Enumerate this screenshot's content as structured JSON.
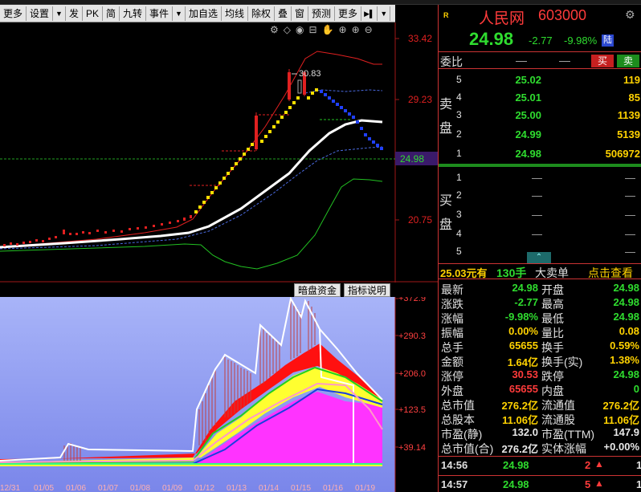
{
  "toolbar": {
    "items": [
      "更多",
      "设置",
      "发",
      "PK",
      "简",
      "九转",
      "事件",
      "加自选",
      "均线",
      "除权",
      "叠",
      "窗",
      "预测",
      "更多"
    ]
  },
  "main_chart": {
    "y_labels": [
      "33.42",
      "29.23",
      "24.98",
      "20.75"
    ],
    "peak_label": "30.83",
    "current_price_label": "24.98"
  },
  "sub_chart": {
    "buttons": [
      "暗盘资金",
      "指标说明"
    ],
    "y_labels": [
      "+372.9",
      "+290.3",
      "+206.0",
      "+123.5",
      "+39.14"
    ],
    "x_labels": [
      "12/31",
      "01/05",
      "01/06",
      "01/07",
      "01/08",
      "01/09",
      "01/12",
      "01/13",
      "01/14",
      "01/15",
      "01/16",
      "01/19"
    ]
  },
  "stock": {
    "market_logo": "R",
    "name": "人民网",
    "code": "603000",
    "last": "24.98",
    "change": "-2.77",
    "pct": "-9.98%",
    "market": "陆",
    "colors": {
      "up": "#ff3b3b",
      "down": "#2fdc2f",
      "volume": "#ffd200"
    }
  },
  "order_book": {
    "ratio_label": "委比",
    "ratio_dash_1": "—",
    "ratio_dash_2": "—",
    "buy_label": "买",
    "sell_label": "卖",
    "sell_side_label_1": "卖",
    "sell_side_label_2": "盘",
    "buy_side_label_1": "买",
    "buy_side_label_2": "盘",
    "sell": [
      {
        "level": "5",
        "price": "25.02",
        "vol": "119"
      },
      {
        "level": "4",
        "price": "25.01",
        "vol": "85"
      },
      {
        "level": "3",
        "price": "25.00",
        "vol": "1139"
      },
      {
        "level": "2",
        "price": "24.99",
        "vol": "5139"
      },
      {
        "level": "1",
        "price": "24.98",
        "vol": "506972"
      }
    ],
    "buy": [
      {
        "level": "1",
        "price": "—",
        "vol": "—"
      },
      {
        "level": "2",
        "price": "—",
        "vol": "—"
      },
      {
        "level": "3",
        "price": "—",
        "vol": "—"
      },
      {
        "level": "4",
        "price": "—",
        "vol": "—"
      },
      {
        "level": "5",
        "price": "—",
        "vol": "—"
      }
    ]
  },
  "big_order": {
    "price": "25.03元有",
    "hands": "130手",
    "label": "大卖单",
    "link": "点击查看"
  },
  "quote": [
    {
      "k1": "最新",
      "v1": "24.98",
      "c1": "grn",
      "k2": "开盘",
      "v2": "24.98",
      "c2": "grn"
    },
    {
      "k1": "涨跌",
      "v1": "-2.77",
      "c1": "grn",
      "k2": "最高",
      "v2": "24.98",
      "c2": "grn"
    },
    {
      "k1": "涨幅",
      "v1": "-9.98%",
      "c1": "grn",
      "k2": "最低",
      "v2": "24.98",
      "c2": "grn"
    },
    {
      "k1": "振幅",
      "v1": "0.00%",
      "c1": "yel",
      "k2": "量比",
      "v2": "0.08",
      "c2": "yel"
    },
    {
      "k1": "总手",
      "v1": "65655",
      "c1": "yel",
      "k2": "换手",
      "v2": "0.59%",
      "c2": "yel"
    },
    {
      "k1": "金额",
      "v1": "1.64亿",
      "c1": "yel",
      "k2": "换手(实)",
      "v2": "1.38%",
      "c2": "yel"
    },
    {
      "k1": "涨停",
      "v1": "30.53",
      "c1": "red",
      "k2": "跌停",
      "v2": "24.98",
      "c2": "grn"
    },
    {
      "k1": "外盘",
      "v1": "65655",
      "c1": "red",
      "k2": "内盘",
      "v2": "0",
      "c2": "grn"
    },
    {
      "k1": "总市值",
      "v1": "276.2亿",
      "c1": "yel",
      "k2": "流通值",
      "v2": "276.2亿",
      "c2": "yel"
    },
    {
      "k1": "总股本",
      "v1": "11.06亿",
      "c1": "yel",
      "k2": "流通股",
      "v2": "11.06亿",
      "c2": "yel"
    },
    {
      "k1": "市盈(静)",
      "v1": "132.0",
      "c1": "wht",
      "k2": "市盈(TTM)",
      "v2": "147.9",
      "c2": "wht"
    },
    {
      "k1": "总市值(合)",
      "v1": "276.2亿",
      "c1": "wht",
      "k2": "实体涨幅",
      "v2": "+0.00%",
      "c2": "wht"
    }
  ],
  "ticks": [
    {
      "time": "14:56",
      "price": "24.98",
      "vol": "2",
      "dir": "1"
    },
    {
      "time": "14:57",
      "price": "24.98",
      "vol": "5",
      "dir": "1"
    }
  ]
}
